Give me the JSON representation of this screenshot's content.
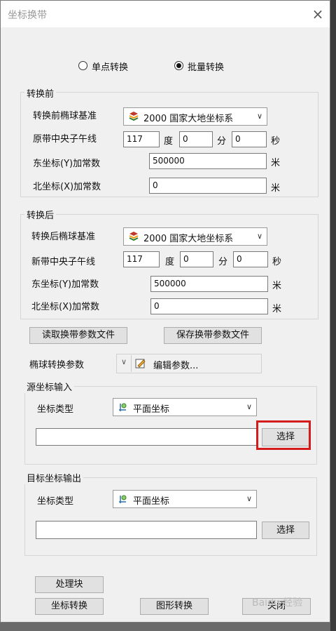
{
  "window": {
    "title": "坐标换带",
    "close_icon": "×"
  },
  "mode": {
    "single_label": "单点转换",
    "batch_label": "批量转换",
    "selected": "batch"
  },
  "before": {
    "group_title": "转换前",
    "ellipsoid_label": "转换前椭球基准",
    "ellipsoid_value": "2000 国家大地坐标系",
    "meridian_label": "原带中央子午线",
    "deg": "117",
    "deg_unit": "度",
    "min": "0",
    "min_unit": "分",
    "sec": "0",
    "sec_unit": "秒",
    "east_label": "东坐标(Y)加常数",
    "east_value": "500000",
    "east_unit": "米",
    "north_label": "北坐标(X)加常数",
    "north_value": "0",
    "north_unit": "米"
  },
  "after": {
    "group_title": "转换后",
    "ellipsoid_label": "转换后椭球基准",
    "ellipsoid_value": "2000 国家大地坐标系",
    "meridian_label": "新带中央子午线",
    "deg": "117",
    "deg_unit": "度",
    "min": "0",
    "min_unit": "分",
    "sec": "0",
    "sec_unit": "秒",
    "east_label": "东坐标(Y)加常数",
    "east_value": "500000",
    "east_unit": "米",
    "north_label": "北坐标(X)加常数",
    "north_value": "0",
    "north_unit": "米"
  },
  "params": {
    "read_button": "读取换带参数文件",
    "save_button": "保存换带参数文件",
    "ellipsoid_param_label": "椭球转换参数",
    "edit_label": "编辑参数..."
  },
  "source": {
    "group_title": "源坐标输入",
    "type_label": "坐标类型",
    "type_value": "平面坐标",
    "path_value": "",
    "select_button": "选择"
  },
  "target": {
    "group_title": "目标坐标输出",
    "type_label": "坐标类型",
    "type_value": "平面坐标",
    "path_value": "",
    "select_button": "选择"
  },
  "footer": {
    "process_button": "处理块",
    "coord_convert_button": "坐标转换",
    "graphic_convert_button": "图形转换",
    "close_button": "关闭"
  },
  "watermark": "Baidu 经验",
  "colors": {
    "highlight": "#d41c1c",
    "window_bg": "#f0f0f0"
  }
}
